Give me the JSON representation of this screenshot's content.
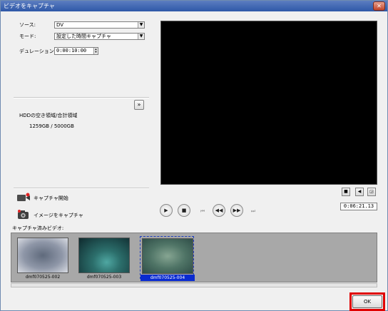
{
  "window": {
    "title": "ビデオをキャプチャ",
    "close_label": "✕"
  },
  "settings": {
    "source_label": "ソース:",
    "source_value": "DV",
    "mode_label": "モード:",
    "mode_value": "設定した時間キャプチャ",
    "duration_label": "デュレーション:",
    "duration_value": "0:00:10:00"
  },
  "disk": {
    "header": "HDDの空き領域/合計領域",
    "value": "1259GB / 5000GB"
  },
  "actions": {
    "start_capture": "キャプチャ開始",
    "capture_image": "イメージをキャプチャ"
  },
  "player": {
    "timecode": "0:06:21.13"
  },
  "captured": {
    "label": "キャプチャ済みビデオ:",
    "items": [
      {
        "name": "dmf070525-002",
        "color": "#5f6a7c"
      },
      {
        "name": "dmf070525-003",
        "color": "#2c6f6c"
      },
      {
        "name": "dmf070525-004",
        "color": "#4f7466",
        "selected": true
      }
    ]
  },
  "footer": {
    "ok_label": "OK"
  }
}
